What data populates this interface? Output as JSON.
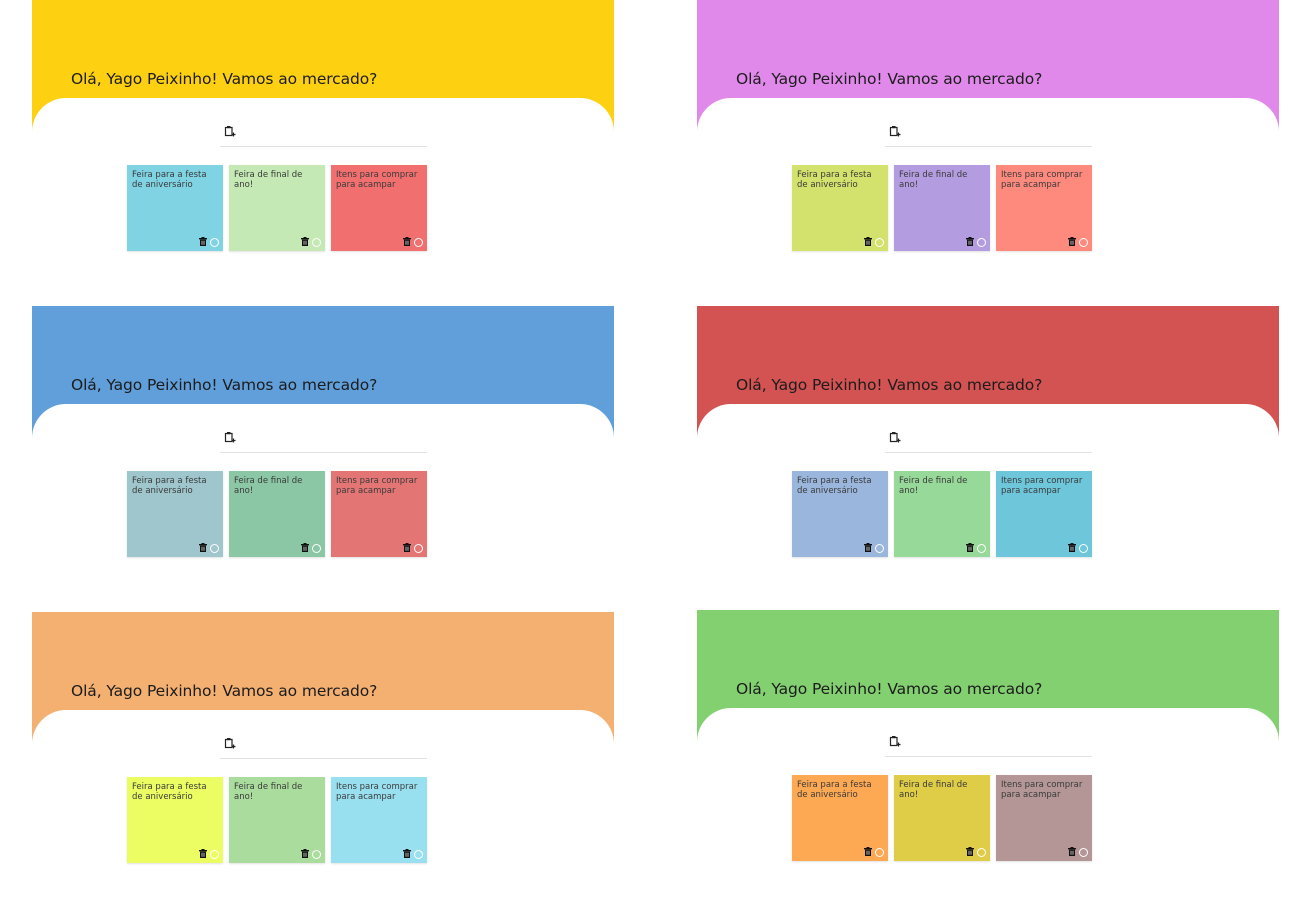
{
  "greeting": "Olá, Yago Peixinho! Vamos ao mercado?",
  "notes": [
    "Feira para a festa de aniversário",
    "Feira de final de ano!",
    "Itens para comprar para acampar"
  ],
  "icons": {
    "add": "add-note-icon",
    "trash": "trash-icon",
    "check": "check-circle-icon"
  },
  "themes": [
    {
      "header": "#fdd012",
      "notes": [
        "#7fd3e3",
        "#c5e9b4",
        "#f16f6f"
      ]
    },
    {
      "header": "#e189eb",
      "notes": [
        "#d3e26d",
        "#b39de0",
        "#fe897d"
      ]
    },
    {
      "header": "#619fdb",
      "notes": [
        "#9ec6cc",
        "#8bc7a5",
        "#e47575"
      ]
    },
    {
      "header": "#d35252",
      "notes": [
        "#9ab6dc",
        "#97d999",
        "#6dc6da"
      ]
    },
    {
      "header": "#f4b071",
      "notes": [
        "#ebfd62",
        "#aadc9d",
        "#98e0f0"
      ]
    },
    {
      "header": "#83d071",
      "notes": [
        "#fda852",
        "#dfcc47",
        "#b39695"
      ]
    }
  ]
}
